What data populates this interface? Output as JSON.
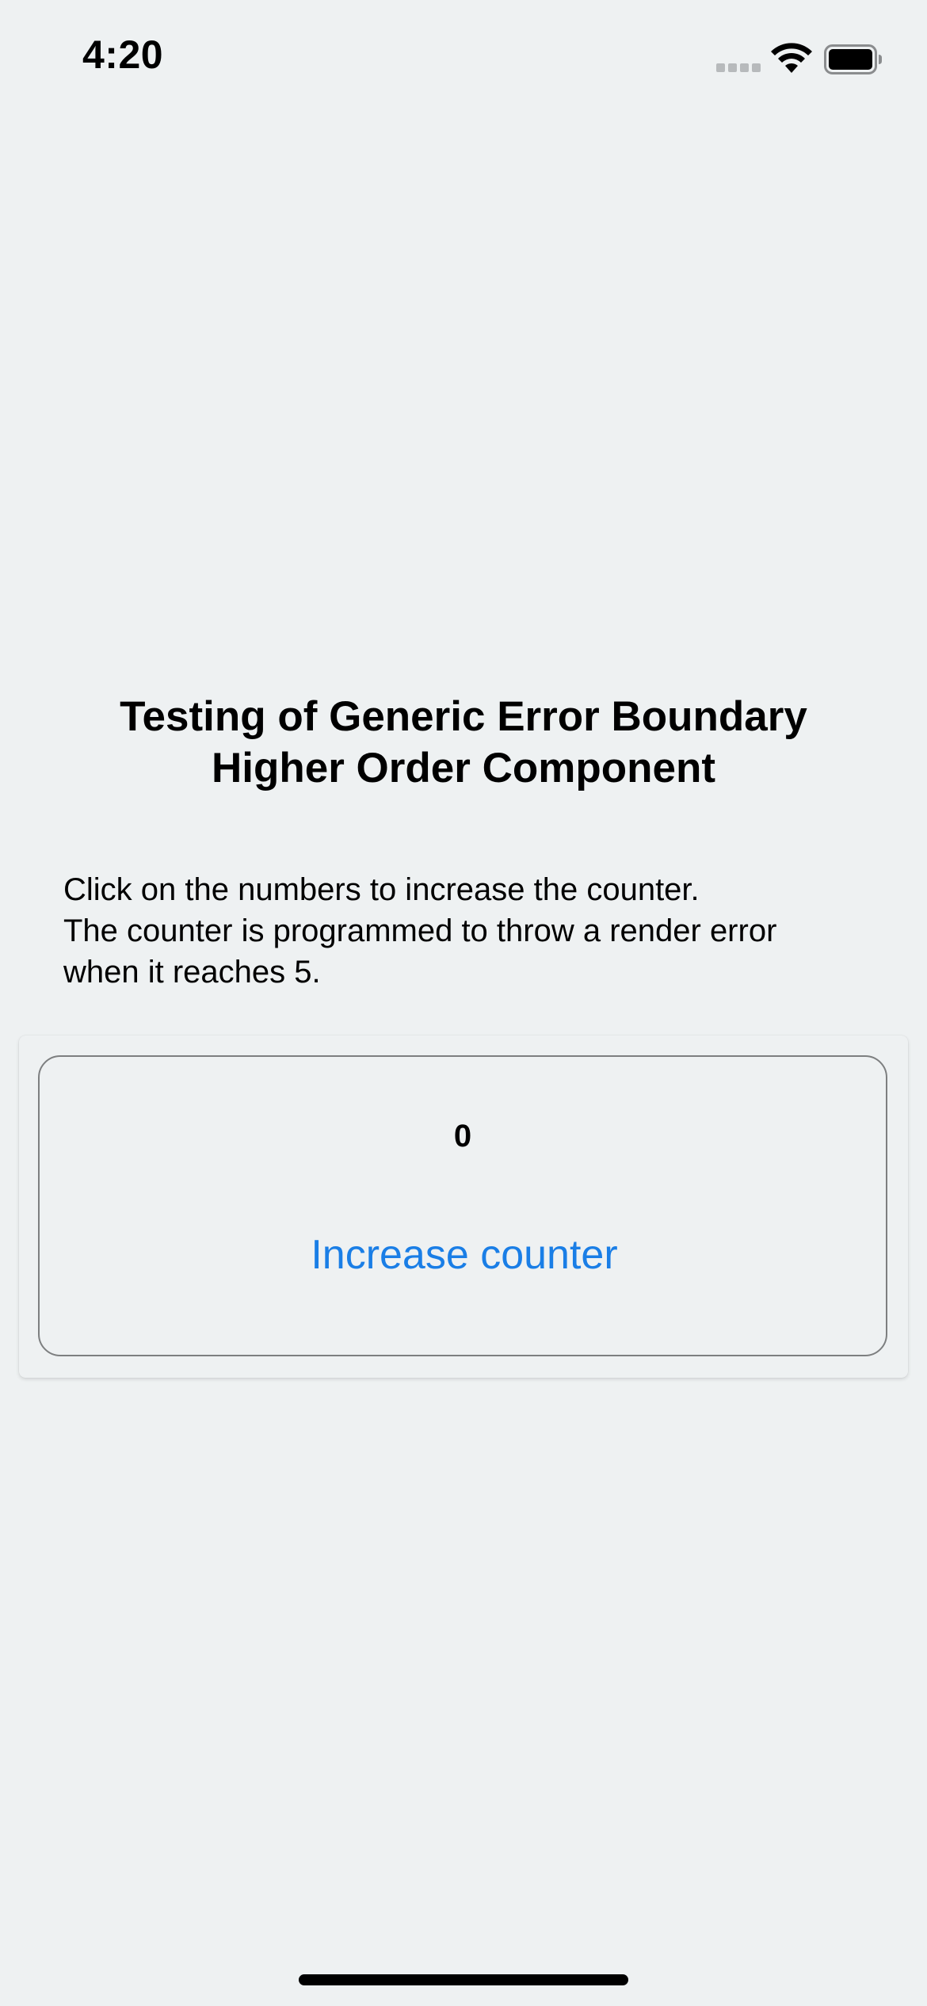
{
  "status_bar": {
    "time": "4:20",
    "signal_icon": "cellular-signal-icon",
    "wifi_icon": "wifi-icon",
    "battery_icon": "battery-icon"
  },
  "header": {
    "title_line1": "Testing of Generic Error Boundary",
    "title_line2": "Higher Order Component"
  },
  "description": {
    "line1": "Click on the numbers to increase the counter.",
    "line2": "The counter is programmed to throw a render error",
    "line3": "when it reaches 5."
  },
  "counter": {
    "value": "0",
    "button_label": "Increase counter"
  },
  "colors": {
    "background": "#eef1f2",
    "accent": "#1a7ee6",
    "border": "#7d7f80"
  }
}
